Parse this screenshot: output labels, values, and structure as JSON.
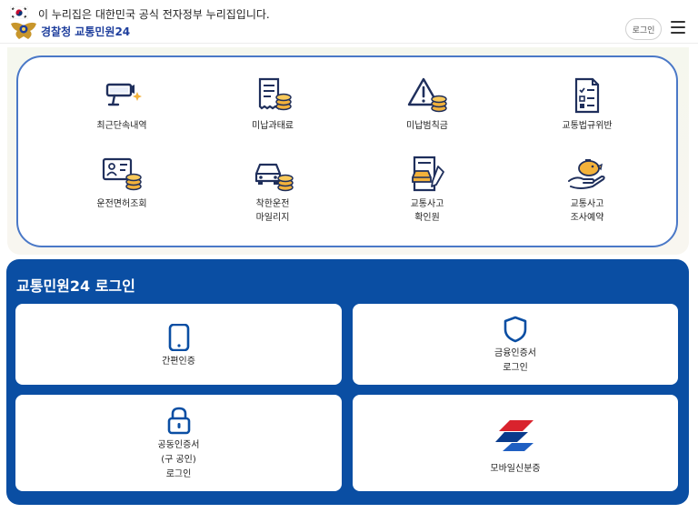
{
  "header": {
    "gov_notice": "이 누리집은 대한민국 공식 전자정부 누리집입니다.",
    "site_title": "경찰청 교통민원24",
    "login_label": "로그인"
  },
  "services": [
    {
      "label": "최근단속내역"
    },
    {
      "label": "미납과태료"
    },
    {
      "label": "미납범칙금"
    },
    {
      "label": "교통법규위반"
    },
    {
      "label": "운전면허조회"
    },
    {
      "label": "착한운전\n마일리지"
    },
    {
      "label": "교통사고\n확인원"
    },
    {
      "label": "교통사고\n조사예약"
    }
  ],
  "login": {
    "title": "교통민원24 로그인",
    "cards": [
      {
        "label": "간편인증"
      },
      {
        "label": "금융인증서\n로그인"
      },
      {
        "label": "공동인증서\n(구 공인)\n로그인"
      },
      {
        "label": "모바일신분증"
      }
    ]
  },
  "colors": {
    "brand_blue": "#0a4ea3",
    "outline_blue": "#4a78c7",
    "accent_gold": "#f3b23b",
    "icon_navy": "#1f2f5c"
  }
}
